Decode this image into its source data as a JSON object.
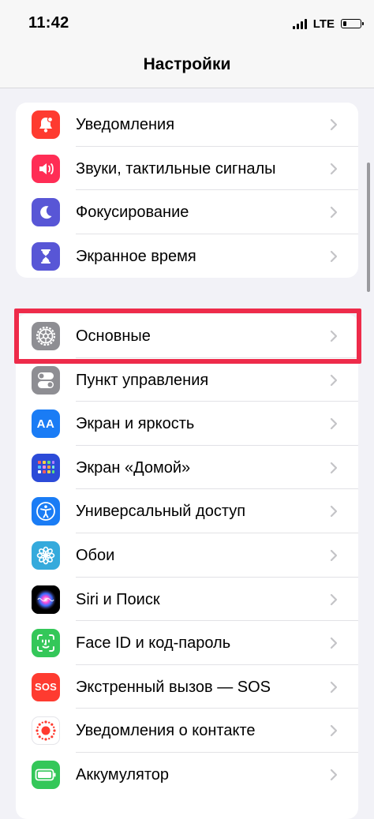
{
  "status_bar": {
    "time": "11:42",
    "network": "LTE",
    "battery_level": 0.18
  },
  "nav": {
    "title": "Настройки"
  },
  "groups": [
    {
      "items": [
        {
          "label": "Уведомления",
          "icon": "bell-icon",
          "color": "#fe3b30"
        },
        {
          "label": "Звуки, тактильные сигналы",
          "icon": "speaker-icon",
          "color": "#ff2d55"
        },
        {
          "label": "Фокусирование",
          "icon": "moon-icon",
          "color": "#5856d6"
        },
        {
          "label": "Экранное время",
          "icon": "hourglass-icon",
          "color": "#5856d6"
        }
      ]
    },
    {
      "items": [
        {
          "label": "Основные",
          "icon": "gear-icon",
          "color": "#8e8e93"
        },
        {
          "label": "Пункт управления",
          "icon": "toggles-icon",
          "color": "#8e8e93"
        },
        {
          "label": "Экран и яркость",
          "icon": "text-size-icon",
          "icon_text": "AA",
          "color": "#1a7cf5"
        },
        {
          "label": "Экран «Домой»",
          "icon": "home-grid-icon",
          "color": "#2c4bd8"
        },
        {
          "label": "Универсальный доступ",
          "icon": "accessibility-icon",
          "color": "#1a7cf5"
        },
        {
          "label": "Обои",
          "icon": "flower-icon",
          "color": "#35aadc"
        },
        {
          "label": "Siri и Поиск",
          "icon": "siri-icon",
          "color": "#111111"
        },
        {
          "label": "Face ID и код-пароль",
          "icon": "face-id-icon",
          "color": "#34c759"
        },
        {
          "label": "Экстренный вызов — SOS",
          "icon": "sos-icon",
          "icon_text": "SOS",
          "color": "#fe3b30"
        },
        {
          "label": "Уведомления о контакте",
          "icon": "exposure-icon",
          "color": "#ffffff"
        },
        {
          "label": "Аккумулятор",
          "icon": "battery-icon",
          "color": "#34c759"
        }
      ]
    }
  ],
  "highlight": {
    "target": "Основные",
    "color": "#ee2b4a"
  }
}
